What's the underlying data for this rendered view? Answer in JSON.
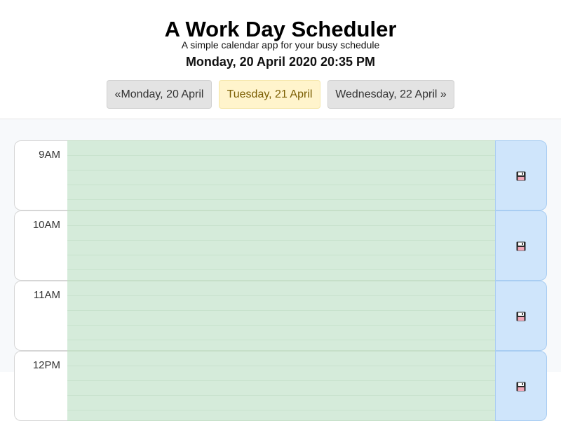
{
  "header": {
    "title": "A Work Day Scheduler",
    "subtitle": "A simple calendar app for your busy schedule",
    "current_datetime": "Monday, 20 April 2020 20:35 PM"
  },
  "day_nav": {
    "previous": "«Monday, 20 April",
    "selected": "Tuesday, 21 April",
    "next": "Wednesday, 22 April »"
  },
  "time_blocks": [
    {
      "hour": "9AM",
      "text": "",
      "status": "future"
    },
    {
      "hour": "10AM",
      "text": "",
      "status": "future"
    },
    {
      "hour": "11AM",
      "text": "",
      "status": "future"
    },
    {
      "hour": "12PM",
      "text": "",
      "status": "future"
    }
  ],
  "icons": {
    "save": "floppy-disk-icon"
  },
  "colors": {
    "future_block": "#d5ebda",
    "save_button": "#cfe5fb",
    "selected_day": "#fff4cc",
    "nav_button": "#e3e3e3"
  }
}
